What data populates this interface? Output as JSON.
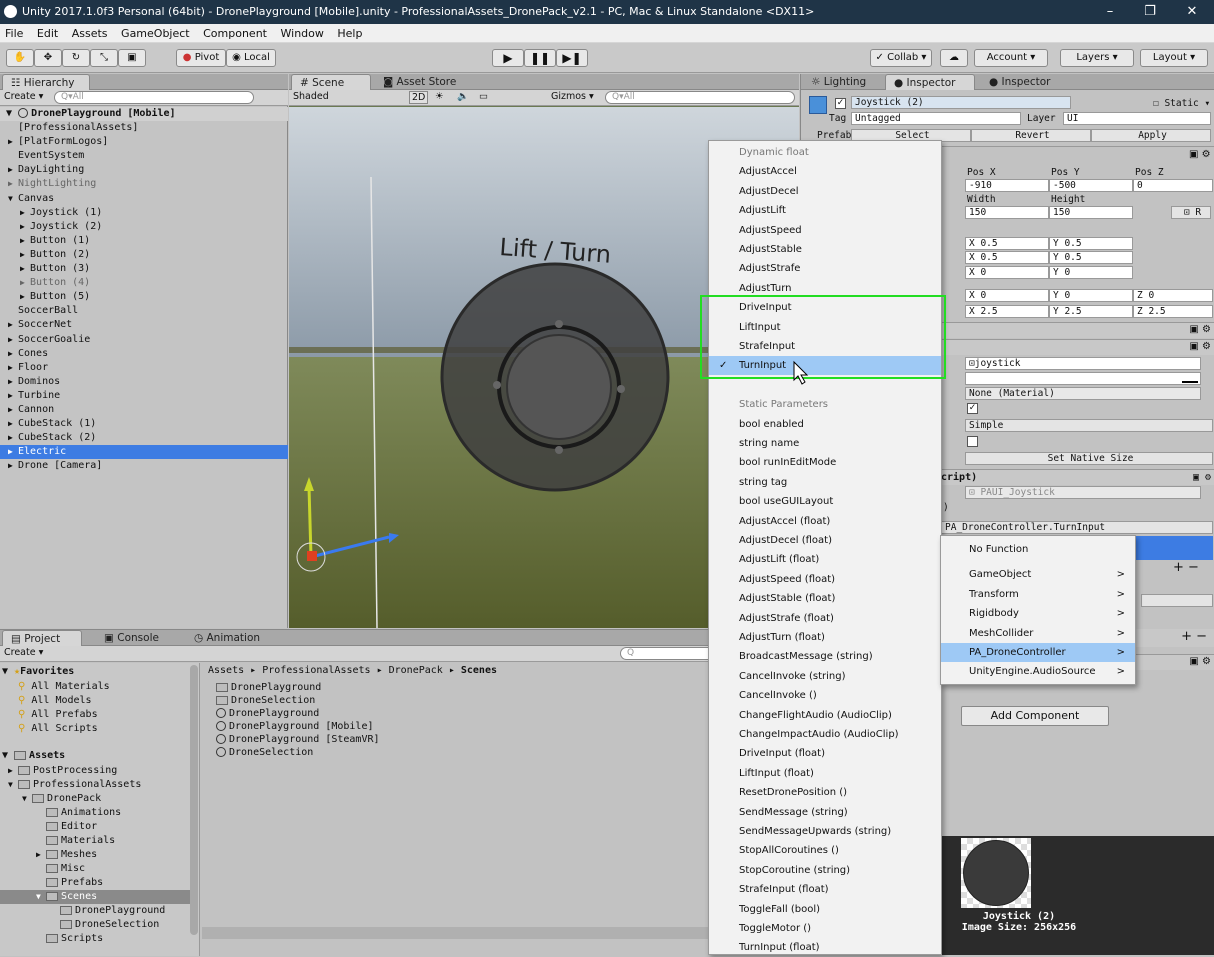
{
  "window": {
    "title": "Unity 2017.1.0f3 Personal (64bit) - DronePlayground [Mobile].unity - ProfessionalAssets_DronePack_v2.1 - PC, Mac & Linux Standalone <DX11>",
    "minimize": "–",
    "maximize": "❐",
    "close": "✕"
  },
  "menu": [
    "File",
    "Edit",
    "Assets",
    "GameObject",
    "Component",
    "Window",
    "Help"
  ],
  "toolbar": {
    "pivot": "Pivot",
    "local": "Local",
    "collab": "Collab ▾",
    "account": "Account",
    "layers": "Layers",
    "layout": "Layout"
  },
  "hierarchy": {
    "tab": "Hierarchy",
    "create": "Create ▾",
    "search_placeholder": "Q▾All",
    "scene": "DronePlayground [Mobile]",
    "items": [
      {
        "label": "[ProfessionalAssets]",
        "depth": 1,
        "arrow": "",
        "dim": false
      },
      {
        "label": "[PlatFormLogos]",
        "depth": 1,
        "arrow": "▶",
        "dim": false
      },
      {
        "label": "EventSystem",
        "depth": 1,
        "arrow": "",
        "dim": false
      },
      {
        "label": "DayLighting",
        "depth": 1,
        "arrow": "▶",
        "dim": false
      },
      {
        "label": "NightLighting",
        "depth": 1,
        "arrow": "▶",
        "dim": true
      },
      {
        "label": "Canvas",
        "depth": 1,
        "arrow": "▼",
        "dim": false
      },
      {
        "label": "Joystick (1)",
        "depth": 2,
        "arrow": "▶",
        "dim": false
      },
      {
        "label": "Joystick (2)",
        "depth": 2,
        "arrow": "▶",
        "dim": false
      },
      {
        "label": "Button (1)",
        "depth": 2,
        "arrow": "▶",
        "dim": false
      },
      {
        "label": "Button (2)",
        "depth": 2,
        "arrow": "▶",
        "dim": false
      },
      {
        "label": "Button (3)",
        "depth": 2,
        "arrow": "▶",
        "dim": false
      },
      {
        "label": "Button (4)",
        "depth": 2,
        "arrow": "▶",
        "dim": true
      },
      {
        "label": "Button (5)",
        "depth": 2,
        "arrow": "▶",
        "dim": false
      },
      {
        "label": "SoccerBall",
        "depth": 1,
        "arrow": "",
        "dim": false
      },
      {
        "label": "SoccerNet",
        "depth": 1,
        "arrow": "▶",
        "dim": false
      },
      {
        "label": "SoccerGoalie",
        "depth": 1,
        "arrow": "▶",
        "dim": false
      },
      {
        "label": "Cones",
        "depth": 1,
        "arrow": "▶",
        "dim": false
      },
      {
        "label": "Floor",
        "depth": 1,
        "arrow": "▶",
        "dim": false
      },
      {
        "label": "Dominos",
        "depth": 1,
        "arrow": "▶",
        "dim": false
      },
      {
        "label": "Turbine",
        "depth": 1,
        "arrow": "▶",
        "dim": false
      },
      {
        "label": "Cannon",
        "depth": 1,
        "arrow": "▶",
        "dim": false
      },
      {
        "label": "CubeStack (1)",
        "depth": 1,
        "arrow": "▶",
        "dim": false
      },
      {
        "label": "CubeStack (2)",
        "depth": 1,
        "arrow": "▶",
        "dim": false
      },
      {
        "label": "Electric",
        "depth": 1,
        "arrow": "▶",
        "dim": false,
        "selected": true
      },
      {
        "label": "Drone [Camera]",
        "depth": 1,
        "arrow": "▶",
        "dim": false
      }
    ]
  },
  "scene": {
    "tab": "Scene",
    "tab2": "Asset Store",
    "shading": "Shaded",
    "mode2d": "2D",
    "gizmos": "Gizmos ▾",
    "search_placeholder": "Q▾All",
    "overlay_text": "Lift / Turn"
  },
  "project": {
    "tabs": [
      "Project",
      "Console",
      "Animation"
    ],
    "create": "Create ▾",
    "favorites_label": "Favorites",
    "favorites": [
      "All Materials",
      "All Models",
      "All Prefabs",
      "All Scripts"
    ],
    "assets_label": "Assets",
    "tree": [
      {
        "label": "PostProcessing",
        "depth": 1,
        "arrow": "▶"
      },
      {
        "label": "ProfessionalAssets",
        "depth": 1,
        "arrow": "▼"
      },
      {
        "label": "DronePack",
        "depth": 2,
        "arrow": "▼"
      },
      {
        "label": "Animations",
        "depth": 3,
        "arrow": ""
      },
      {
        "label": "Editor",
        "depth": 3,
        "arrow": ""
      },
      {
        "label": "Materials",
        "depth": 3,
        "arrow": ""
      },
      {
        "label": "Meshes",
        "depth": 3,
        "arrow": "▶"
      },
      {
        "label": "Misc",
        "depth": 3,
        "arrow": ""
      },
      {
        "label": "Prefabs",
        "depth": 3,
        "arrow": ""
      },
      {
        "label": "Scenes",
        "depth": 3,
        "arrow": "▼",
        "selected": true
      },
      {
        "label": "DronePlayground",
        "depth": 4,
        "arrow": ""
      },
      {
        "label": "DroneSelection",
        "depth": 4,
        "arrow": ""
      },
      {
        "label": "Scripts",
        "depth": 3,
        "arrow": ""
      }
    ],
    "breadcrumb": [
      "Assets",
      "ProfessionalAssets",
      "DronePack",
      "Scenes"
    ],
    "files": [
      {
        "label": "DronePlayground",
        "kind": "folder"
      },
      {
        "label": "DroneSelection",
        "kind": "folder"
      },
      {
        "label": "DronePlayground",
        "kind": "scene"
      },
      {
        "label": "DronePlayground [Mobile]",
        "kind": "scene"
      },
      {
        "label": "DronePlayground [SteamVR]",
        "kind": "scene"
      },
      {
        "label": "DroneSelection",
        "kind": "scene"
      }
    ]
  },
  "inspector": {
    "tabs": [
      "Lighting",
      "Inspector",
      "Inspector"
    ],
    "object_name": "Joystick (2)",
    "static": "Static ▾",
    "tag_label": "Tag",
    "tag_value": "Untagged",
    "layer_label": "Layer",
    "layer_value": "UI",
    "prefab_label": "Prefab",
    "prefab_buttons": [
      "Select",
      "Revert",
      "Apply"
    ],
    "posx_label": "Pos X",
    "posy_label": "Pos Y",
    "posz_label": "Pos Z",
    "posx": "-910",
    "posy": "-500",
    "posz": "0",
    "width_label": "Width",
    "height_label": "Height",
    "width": "150",
    "height": "150",
    "anchor_min": [
      "0.5",
      "0.5"
    ],
    "anchor_max": [
      "0.5",
      "0.5"
    ],
    "pivot": [
      "0",
      "0"
    ],
    "rotation": [
      "0",
      "0",
      "0"
    ],
    "scale": [
      "2.5",
      "2.5",
      "2.5"
    ],
    "sprite": "joystick",
    "material": "None (Material)",
    "image_type": "Simple",
    "set_native": "Set Native Size",
    "script_header": "cript)",
    "script_value": "PAUI_Joystick",
    "function_value": "PA_DroneController.TurnInput",
    "add_component": "Add Component",
    "preview_name": "Joystick (2)",
    "preview_size": "Image Size: 256x256"
  },
  "function_menu": {
    "items": [
      {
        "label": "Dynamic float",
        "head": true
      },
      {
        "label": "AdjustAccel"
      },
      {
        "label": "AdjustDecel"
      },
      {
        "label": "AdjustLift"
      },
      {
        "label": "AdjustSpeed"
      },
      {
        "label": "AdjustStable"
      },
      {
        "label": "AdjustStrafe"
      },
      {
        "label": "AdjustTurn"
      },
      {
        "label": "DriveInput"
      },
      {
        "label": "LiftInput"
      },
      {
        "label": "StrafeInput"
      },
      {
        "label": "TurnInput",
        "selected": true
      },
      {
        "label": "",
        "spacer": true
      },
      {
        "label": "Static Parameters",
        "head": true
      },
      {
        "label": "bool enabled"
      },
      {
        "label": "string name"
      },
      {
        "label": "bool runInEditMode"
      },
      {
        "label": "string tag"
      },
      {
        "label": "bool useGUILayout"
      },
      {
        "label": "AdjustAccel (float)"
      },
      {
        "label": "AdjustDecel (float)"
      },
      {
        "label": "AdjustLift (float)"
      },
      {
        "label": "AdjustSpeed (float)"
      },
      {
        "label": "AdjustStable (float)"
      },
      {
        "label": "AdjustStrafe (float)"
      },
      {
        "label": "AdjustTurn (float)"
      },
      {
        "label": "BroadcastMessage (string)"
      },
      {
        "label": "CancelInvoke (string)"
      },
      {
        "label": "CancelInvoke ()"
      },
      {
        "label": "ChangeFlightAudio (AudioClip)"
      },
      {
        "label": "ChangeImpactAudio (AudioClip)"
      },
      {
        "label": "DriveInput (float)"
      },
      {
        "label": "LiftInput (float)"
      },
      {
        "label": "ResetDronePosition ()"
      },
      {
        "label": "SendMessage (string)"
      },
      {
        "label": "SendMessageUpwards (string)"
      },
      {
        "label": "StopAllCoroutines ()"
      },
      {
        "label": "StopCoroutine (string)"
      },
      {
        "label": "StrafeInput (float)"
      },
      {
        "label": "ToggleFall (bool)"
      },
      {
        "label": "ToggleMotor ()"
      },
      {
        "label": "TurnInput (float)"
      }
    ],
    "check": "✓"
  },
  "component_menu": {
    "items": [
      {
        "label": "No Function",
        "arrow": ""
      },
      {
        "label": "GameObject",
        "arrow": ">"
      },
      {
        "label": "Transform",
        "arrow": ">"
      },
      {
        "label": "Rigidbody",
        "arrow": ">"
      },
      {
        "label": "MeshCollider",
        "arrow": ">"
      },
      {
        "label": "PA_DroneController",
        "arrow": ">",
        "selected": true
      },
      {
        "label": "UnityEngine.AudioSource",
        "arrow": ">"
      }
    ]
  },
  "colors": {
    "highlight_box": "#22dd22",
    "selection": "#3d7ce3",
    "menu_selection": "#9ec9f5"
  }
}
